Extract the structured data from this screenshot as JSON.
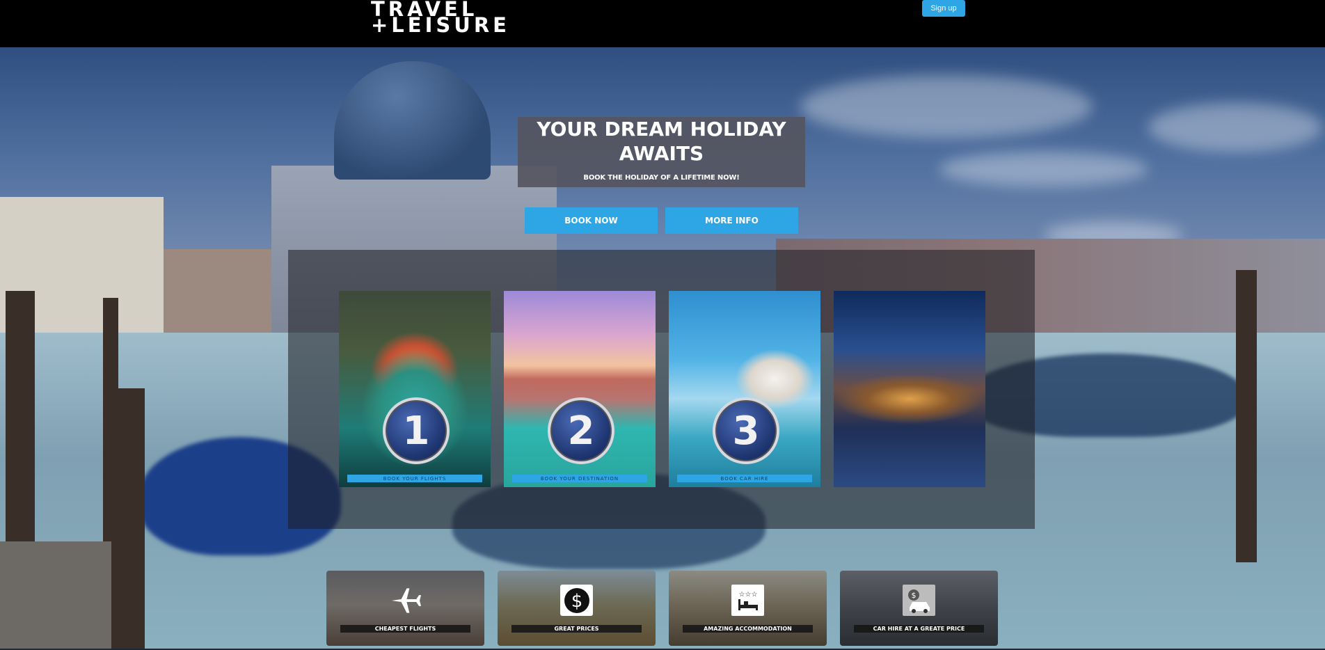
{
  "header": {
    "logo_line1": "TRAVEL",
    "logo_line2": "+LEISURE",
    "signup_label": "Sign up"
  },
  "hero": {
    "title": "YOUR DREAM HOLIDAY AWAITS",
    "subtitle": "BOOK THE HOLIDAY OF A LIFETIME NOW!",
    "book_label": "BOOK NOW",
    "info_label": "MORE INFO"
  },
  "steps": [
    {
      "number": "1",
      "label": "BOOK YOUR FLIGHTS"
    },
    {
      "number": "2",
      "label": "BOOK YOUR DESTINATION"
    },
    {
      "number": "3",
      "label": "BOOK CAR HIRE"
    }
  ],
  "features": [
    {
      "icon": "airplane-icon",
      "label": "CHEAPEST FLIGHTS"
    },
    {
      "icon": "dollar-icon",
      "label": "GREAT PRICES"
    },
    {
      "icon": "hotel-bed-icon",
      "label": "AMAZING ACCOMMODATION"
    },
    {
      "icon": "car-hire-icon",
      "label": "CAR HIRE AT A GREATE PRICE"
    }
  ],
  "colors": {
    "accent": "#2ea6e6",
    "header_bg": "#000000",
    "hero_box": "#55555f"
  }
}
